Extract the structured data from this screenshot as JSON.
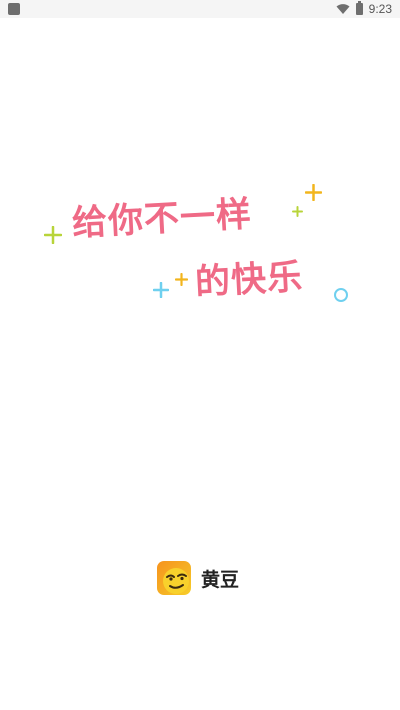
{
  "status_bar": {
    "time": "9:23",
    "left_icon": "app-notification-icon",
    "wifi_icon": "wifi-icon",
    "battery_icon": "battery-icon"
  },
  "slogan": {
    "line1": "给你不一样",
    "line2": "的快乐",
    "color": "#ef6a86"
  },
  "decorations": {
    "plus_green": "#b8d43a",
    "plus_yellow": "#f2b51d",
    "plus_blue": "#6fd0ef",
    "circle_blue": "#6fd0ef"
  },
  "brand": {
    "logo_icon": "smirk-face-icon",
    "name": "黄豆"
  }
}
